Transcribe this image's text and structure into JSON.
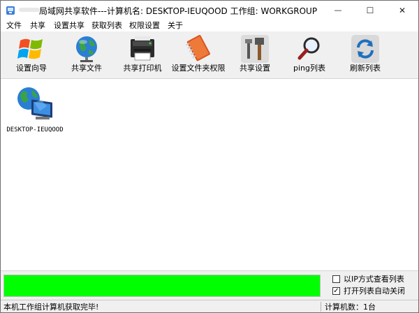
{
  "window": {
    "title": "局域网共享软件---计算机名: DESKTOP-IEUQOOD  工作组: WORKGROUP",
    "controls": {
      "minimize": "—",
      "maximize": "☐",
      "close": "✕"
    }
  },
  "menu": [
    "文件",
    "共享",
    "设置共享",
    "获取列表",
    "权限设置",
    "关于"
  ],
  "toolbar": [
    {
      "label": "设置向导",
      "icon": "windows-logo-icon"
    },
    {
      "label": "共享文件",
      "icon": "globe-icon"
    },
    {
      "label": "共享打印机",
      "icon": "printer-server-icon"
    },
    {
      "label": "设置文件夹权限",
      "icon": "notebook-icon"
    },
    {
      "label": "共享设置",
      "icon": "tools-icon"
    },
    {
      "label": "ping列表",
      "icon": "magnifier-icon"
    },
    {
      "label": "刷新列表",
      "icon": "refresh-icon"
    }
  ],
  "computers": [
    {
      "name": "DESKTOP-IEUQOOD",
      "icon": "network-computer-icon"
    }
  ],
  "progress": {
    "value": 1.0,
    "color": "#00ff00"
  },
  "options": {
    "view_by_ip": {
      "label": "以IP方式查看列表",
      "checked": false,
      "mark": ""
    },
    "auto_close": {
      "label": "打开列表自动关闭",
      "checked": true,
      "mark": "✓"
    }
  },
  "status": {
    "message": "本机工作组计算机获取完毕!",
    "count": "计算机数：1台"
  }
}
